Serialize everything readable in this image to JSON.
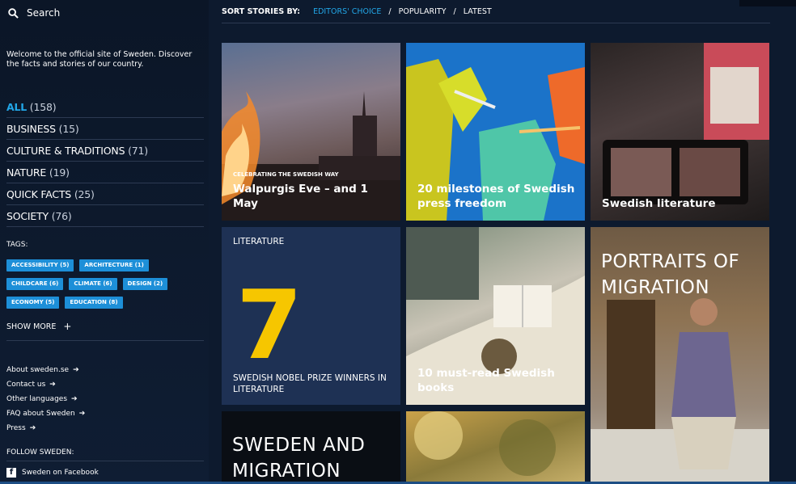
{
  "search": {
    "label": "Search"
  },
  "welcome": "Welcome to the official site of Sweden. Discover the facts and stories of our country.",
  "categories": [
    {
      "label": "ALL",
      "count": "(158)",
      "active": true
    },
    {
      "label": "BUSINESS",
      "count": "(15)"
    },
    {
      "label": "CULTURE & TRADITIONS",
      "count": "(71)"
    },
    {
      "label": "NATURE",
      "count": "(19)"
    },
    {
      "label": "QUICK FACTS",
      "count": "(25)"
    },
    {
      "label": "SOCIETY",
      "count": "(76)"
    }
  ],
  "tags_label": "TAGS:",
  "tags": [
    "ACCESSIBILITY (5)",
    "ARCHITECTURE (1)",
    "CHILDCARE (6)",
    "CLIMATE (6)",
    "DESIGN (2)",
    "ECONOMY (5)",
    "EDUCATION (8)"
  ],
  "show_more": "SHOW MORE",
  "links": [
    "About sweden.se",
    "Contact us",
    "Other languages",
    "FAQ about Sweden",
    "Press"
  ],
  "follow_label": "FOLLOW SWEDEN:",
  "facebook": "Sweden on Facebook",
  "sort": {
    "label": "SORT STORIES BY:",
    "options": [
      "EDITORS' CHOICE",
      "POPULARITY",
      "LATEST"
    ],
    "active_index": 0
  },
  "tiles": {
    "walpurgis": {
      "kicker": "CELEBRATING THE SWEDISH WAY",
      "title": "Walpurgis Eve – and 1 May"
    },
    "press": {
      "title": "20 milestones of Swedish press freedom"
    },
    "literature": {
      "title": "Swedish literature"
    },
    "nobel": {
      "label": "LITERATURE",
      "number": "7",
      "subtitle": "SWEDISH NOBEL PRIZE WINNERS IN LITERATURE"
    },
    "books": {
      "title": "10 must-read Swedish books"
    },
    "portraits": {
      "title": "PORTRAITS OF MIGRATION"
    },
    "migration": {
      "title": "SWEDEN AND MIGRATION"
    }
  },
  "colors": {
    "accent": "#22a7e8",
    "tag_bg": "#1d8fd8",
    "nobel_yellow": "#f6c600",
    "background": "#0d1a2e"
  }
}
